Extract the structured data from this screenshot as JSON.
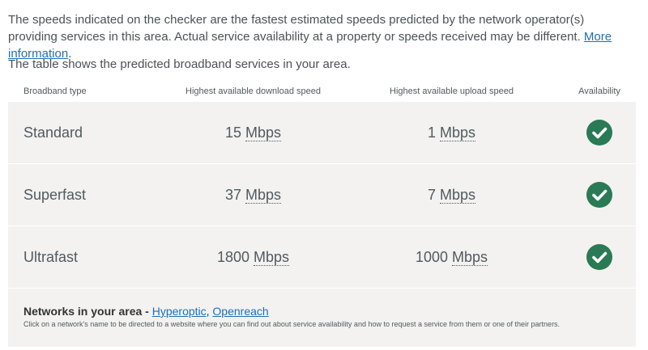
{
  "intro": {
    "text": "The speeds indicated on the checker are the fastest estimated speeds predicted by the network operator(s) providing services in this area. Actual service availability at a property or speeds received may be different.",
    "link": "More information",
    "link_suffix": "."
  },
  "intro2": "The table shows the predicted broadband services in your area.",
  "table": {
    "headers": [
      "Broadband type",
      "Highest available download speed",
      "Highest available upload speed",
      "Availability"
    ],
    "rows": [
      {
        "type": "Standard",
        "down": "15",
        "up": "1",
        "unit": "Mbps",
        "available": "available-check-icon"
      },
      {
        "type": "Superfast",
        "down": "37",
        "up": "7",
        "unit": "Mbps",
        "available": "available-check-icon"
      },
      {
        "type": "Ultrafast",
        "down": "1800",
        "up": "1000",
        "unit": "Mbps",
        "available": "available-check-icon"
      }
    ]
  },
  "footer": {
    "heading": "Networks in your area -",
    "networks": [
      "Hyperoptic",
      "Openreach"
    ],
    "separator": ",",
    "note": "Click on a network's name to be directed to a website where you can find out about service availability and how to request a service from them or one of their partners."
  },
  "colors": {
    "link": "#1d70b8",
    "check": "#2a7a55",
    "row_bg": "#f3f2f1"
  }
}
